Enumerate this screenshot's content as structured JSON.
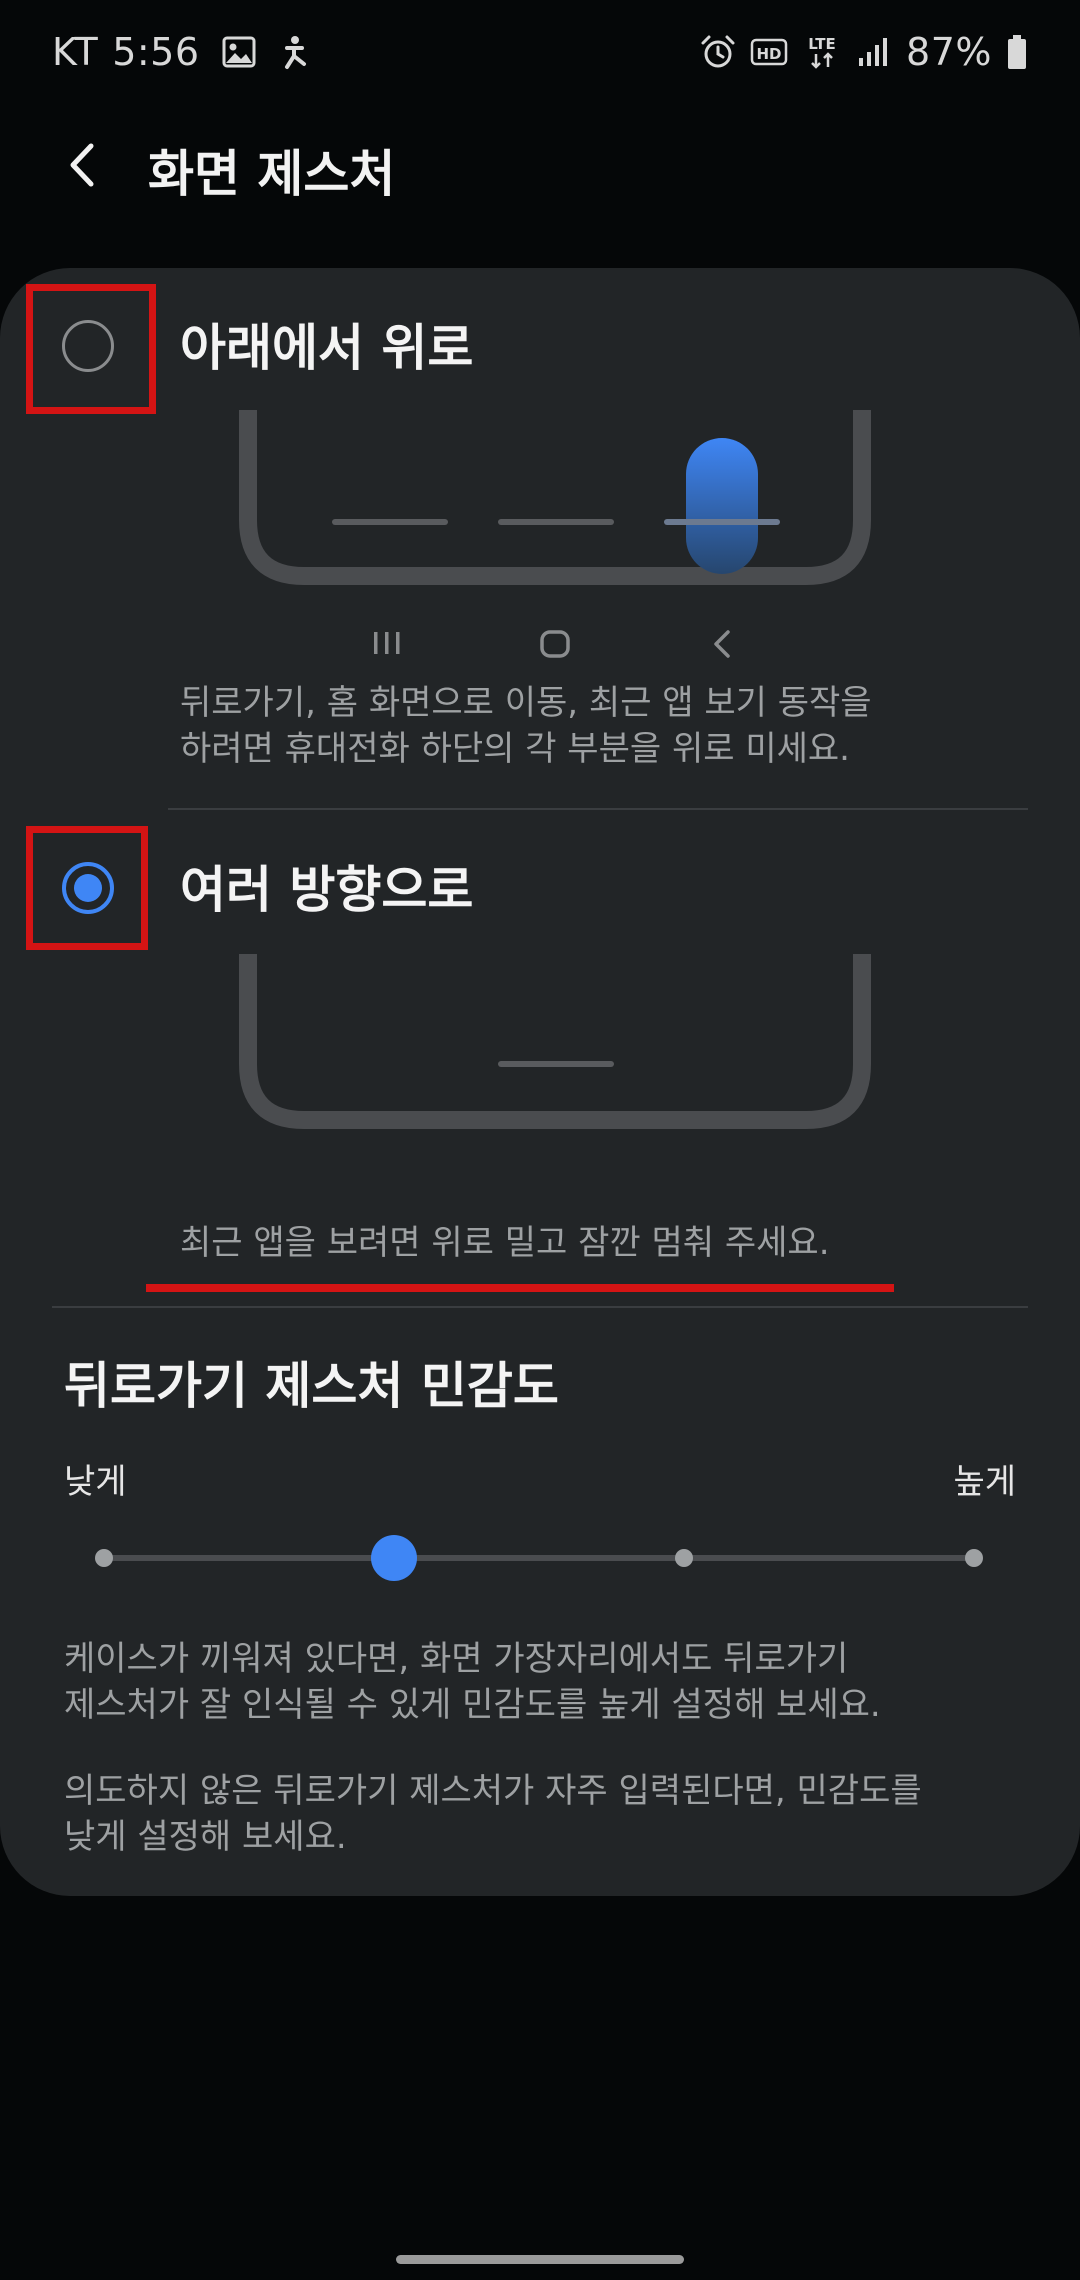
{
  "status_bar": {
    "carrier": "KT",
    "time": "5:56",
    "network": "LTE",
    "hd_badge": "HD",
    "battery_percent": "87%",
    "icons": [
      "image-icon",
      "accessibility-icon",
      "alarm-icon",
      "hd-voice-icon",
      "lte-icon",
      "signal-icon",
      "battery-icon"
    ]
  },
  "header": {
    "title": "화면 제스처"
  },
  "options": [
    {
      "label": "아래에서 위로",
      "selected": false,
      "description_line1": "뒤로가기, 홈 화면으로 이동, 최근 앱 보기 동작을",
      "description_line2": "하려면 휴대전화 하단의 각 부분을 위로 미세요.",
      "nav_icons": [
        "recent-apps-icon",
        "home-icon",
        "back-icon"
      ]
    },
    {
      "label": "여러 방향으로",
      "selected": true,
      "description_line1": "최근 앱을 보려면 위로 밀고 잠깐 멈춰 주세요."
    }
  ],
  "sensitivity": {
    "title": "뒤로가기 제스처 민감도",
    "low_label": "낮게",
    "high_label": "높게",
    "steps": 4,
    "selected_step": 2,
    "accent": "#3f86f5",
    "note1_line1": "케이스가 끼워져 있다면, 화면 가장자리에서도 뒤로가기",
    "note1_line2": "제스처가 잘 인식될 수 있게 민감도를 높게 설정해 보세요.",
    "note2_line1": "의도하지 않은 뒤로가기 제스처가 자주 입력된다면, 민감도를",
    "note2_line2": "낮게 설정해 보세요."
  },
  "colors": {
    "background": "#050708",
    "card": "#222527",
    "accent": "#3f86f5",
    "highlight": "#d41414"
  }
}
